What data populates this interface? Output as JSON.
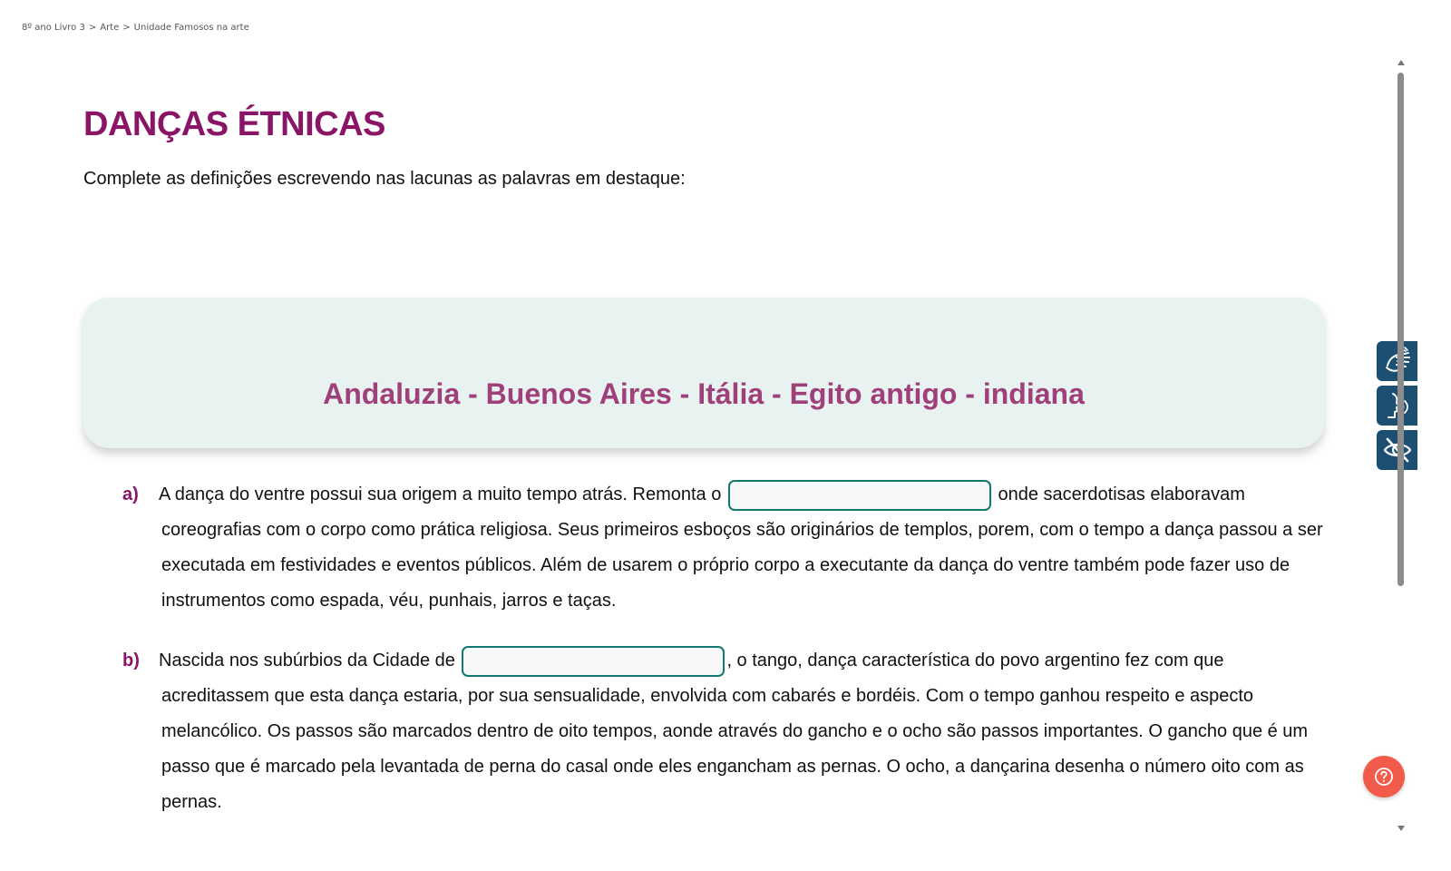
{
  "breadcrumb": {
    "items": [
      "8º ano Livro 3",
      "Arte",
      "Unidade Famosos na arte"
    ],
    "separator": ">"
  },
  "title": "DANÇAS ÉTNICAS",
  "instructions": "Complete as definições escrevendo nas lacunas as palavras em destaque:",
  "word_bank": "Andaluzia - Buenos Aires - Itália - Egito antigo - indiana",
  "questions": {
    "a": {
      "letter": "a)",
      "before_blank": "A dança do ventre possui sua origem a muito tempo atrás. Remonta o",
      "after_blank": "onde sacerdotisas elaboravam",
      "continuation": "coreografias com o corpo como prática religiosa. Seus primeiros esboços são originários de templos, porem, com o tempo a dança passou a ser executada em festividades e eventos públicos. Além de usarem o próprio corpo a executante da dança do ventre também pode fazer uso de instrumentos como espada, véu, punhais, jarros e taças.",
      "blank_value": ""
    },
    "b": {
      "letter": "b)",
      "before_blank": "Nascida nos subúrbios da Cidade de",
      "after_blank": ", o tango, dança característica do povo argentino fez com que",
      "continuation": "acreditassem que esta dança estaria, por sua sensualidade, envolvida com cabarés e bordéis. Com o tempo ganhou respeito e aspecto melancólico. Os passos são marcados dentro de oito tempos, aonde através do gancho e o ocho são passos importantes. O gancho que é um passo que é marcado pela levantada de perna do casal onde eles engancham as pernas. O ocho, a dançarina desenha o número oito com as pernas.",
      "blank_value": ""
    }
  },
  "side_tools": [
    "sign-language-icon",
    "audio-reader-icon",
    "hide-eye-icon"
  ],
  "help": "help-icon",
  "colors": {
    "title": "#8a1466",
    "word_bank": "#a0407a",
    "word_box_bg": "#e8f2f0",
    "blank_border": "#117a70",
    "tool_bg": "#1d4f73",
    "help_bg": "#f25a4a"
  }
}
